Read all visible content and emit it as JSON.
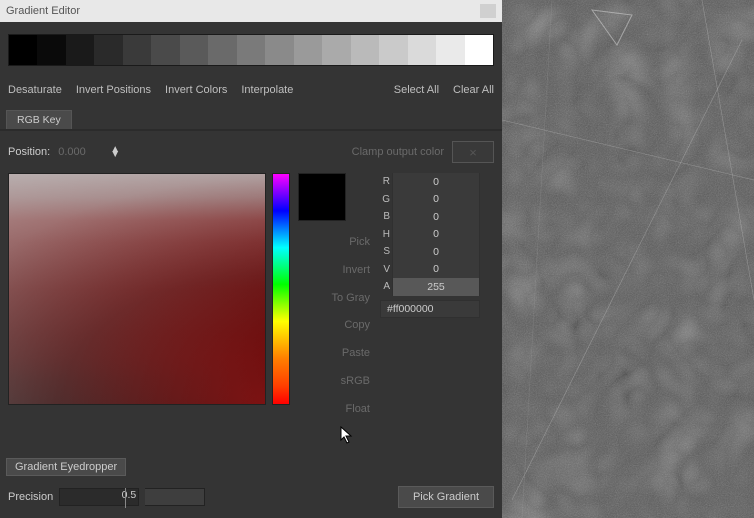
{
  "title": "Gradient Editor",
  "gradient_stops": [
    "#000000",
    "#0a0a0a",
    "#1a1a1a",
    "#2a2a2a",
    "#3a3a3a",
    "#4a4a4a",
    "#5a5a5a",
    "#6a6a6a",
    "#7a7a7a",
    "#8a8a8a",
    "#9a9a9a",
    "#aaaaaa",
    "#bababa",
    "#cacaca",
    "#dadada",
    "#eaeaea",
    "#ffffff"
  ],
  "ops": {
    "desaturate": "Desaturate",
    "invert_positions": "Invert Positions",
    "invert_colors": "Invert Colors",
    "interpolate": "Interpolate",
    "select_all": "Select All",
    "clear_all": "Clear All"
  },
  "tab_label": "RGB Key",
  "position_label": "Position:",
  "position_value": "0.000",
  "clamp_label": "Clamp output color",
  "clamp_icon": "×",
  "mid_buttons": {
    "pick": "Pick",
    "invert": "Invert",
    "to_gray": "To Gray",
    "copy": "Copy",
    "paste": "Paste",
    "srgb": "sRGB",
    "float": "Float"
  },
  "channels": {
    "R": "0",
    "G": "0",
    "B": "0",
    "H": "0",
    "S": "0",
    "V": "0",
    "A": "255"
  },
  "hex": "#ff000000",
  "eyedropper_label": "Gradient Eyedropper",
  "precision_label": "Precision",
  "precision_value": "0.5",
  "pick_gradient_label": "Pick Gradient"
}
